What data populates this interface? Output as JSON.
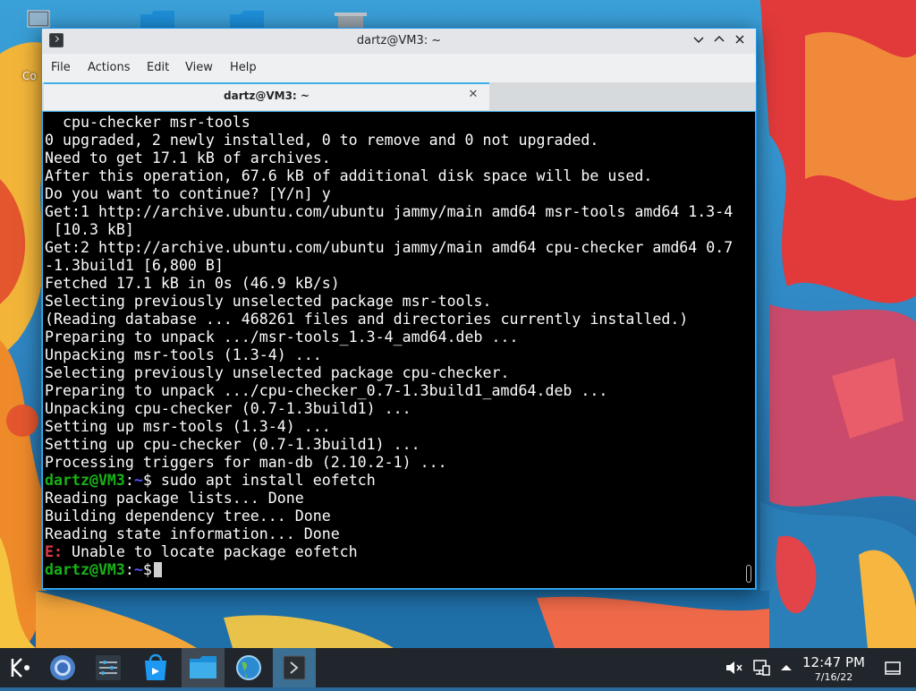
{
  "desktop": {
    "partial_label": "Co"
  },
  "window": {
    "title": "dartz@VM3: ~",
    "tab_title": "dartz@VM3: ~",
    "menu": [
      "File",
      "Actions",
      "Edit",
      "View",
      "Help"
    ]
  },
  "terminal": {
    "lines": [
      "  cpu-checker msr-tools",
      "0 upgraded, 2 newly installed, 0 to remove and 0 not upgraded.",
      "Need to get 17.1 kB of archives.",
      "After this operation, 67.6 kB of additional disk space will be used.",
      "Do you want to continue? [Y/n] y",
      "Get:1 http://archive.ubuntu.com/ubuntu jammy/main amd64 msr-tools amd64 1.3-4",
      " [10.3 kB]",
      "Get:2 http://archive.ubuntu.com/ubuntu jammy/main amd64 cpu-checker amd64 0.7",
      "-1.3build1 [6,800 B]",
      "Fetched 17.1 kB in 0s (46.9 kB/s)",
      "Selecting previously unselected package msr-tools.",
      "(Reading database ... 468261 files and directories currently installed.)",
      "Preparing to unpack .../msr-tools_1.3-4_amd64.deb ...",
      "Unpacking msr-tools (1.3-4) ...",
      "Selecting previously unselected package cpu-checker.",
      "Preparing to unpack .../cpu-checker_0.7-1.3build1_amd64.deb ...",
      "Unpacking cpu-checker (0.7-1.3build1) ...",
      "Setting up msr-tools (1.3-4) ...",
      "Setting up cpu-checker (0.7-1.3build1) ...",
      "Processing triggers for man-db (2.10.2-1) ..."
    ],
    "prompt_user": "dartz@VM3",
    "prompt_sep": ":",
    "prompt_path": "~",
    "prompt_symbol": "$",
    "command": " sudo apt install eofetch",
    "after_lines": [
      "Reading package lists... Done",
      "Building dependency tree... Done",
      "Reading state information... Done"
    ],
    "error_prefix": "E:",
    "error_text": " Unable to locate package eofetch"
  },
  "taskbar": {
    "items": [
      "app-launcher-icon",
      "chromium-icon",
      "system-settings-icon",
      "discover-icon",
      "dolphin-icon",
      "browser-globe-icon",
      "konsole-icon"
    ],
    "tray": [
      "volume-muted-icon",
      "network-icon",
      "tray-expand-icon"
    ],
    "clock_time": "12:47 PM",
    "clock_date": "7/16/22",
    "colors": {
      "panel": "#20262c",
      "accent": "#3daee9"
    }
  }
}
